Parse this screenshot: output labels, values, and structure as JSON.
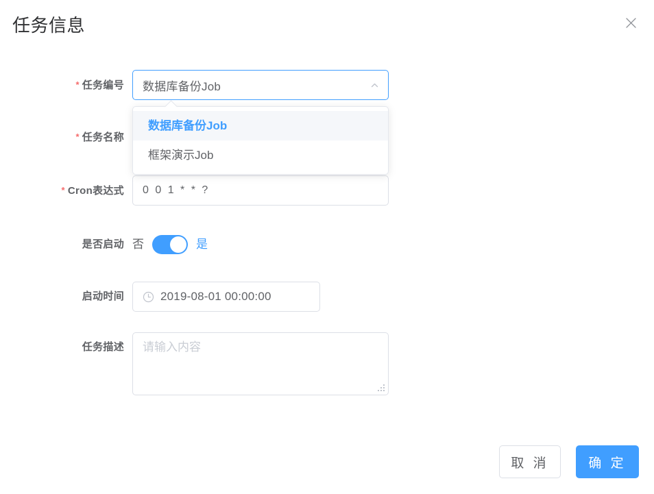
{
  "dialog": {
    "title": "任务信息",
    "close_icon": "close-icon"
  },
  "form": {
    "job_no": {
      "label": "任务编号",
      "required_mark": "*",
      "value": "数据库备份Job",
      "suffix_icon": "chevron-up-icon",
      "options": [
        {
          "label": "数据库备份Job",
          "selected": true
        },
        {
          "label": "框架演示Job",
          "selected": false
        }
      ]
    },
    "job_name": {
      "label": "任务名称",
      "required_mark": "*",
      "value": ""
    },
    "cron": {
      "label": "Cron表达式",
      "required_mark": "*",
      "value": "0 0 1 * * ?"
    },
    "enabled": {
      "label": "是否启动",
      "off_text": "否",
      "on_text": "是",
      "state": "on"
    },
    "start_time": {
      "label": "启动时间",
      "value": "2019-08-01 00:00:00",
      "prefix_icon": "clock-icon"
    },
    "description": {
      "label": "任务描述",
      "value": "",
      "placeholder": "请输入内容",
      "resize_handle": "resize-grip-icon"
    }
  },
  "footer": {
    "cancel_label": "取 消",
    "confirm_label": "确 定"
  },
  "colors": {
    "primary": "#409eff",
    "required": "#f56c6c",
    "border": "#dcdfe6",
    "text": "#606266",
    "title": "#303133",
    "selected_bg": "#f5f7fa"
  }
}
